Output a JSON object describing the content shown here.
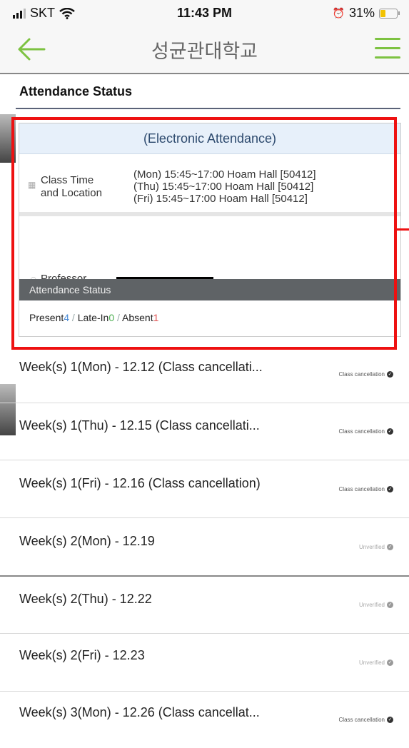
{
  "status_bar": {
    "carrier": "SKT",
    "time": "11:43 PM",
    "battery": "31%"
  },
  "nav": {
    "title": "성균관대학교"
  },
  "section": {
    "title": "Attendance Status"
  },
  "card": {
    "header": "(Electronic Attendance)",
    "class_time_label": "Class Time\nand Location",
    "class_times": [
      "(Mon) 15:45~17:00 Hoam Hall [50412]",
      "(Thu) 15:45~17:00 Hoam Hall [50412]",
      "(Fri) 15:45~17:00 Hoam Hall [50412]"
    ],
    "professor_label": "Professor",
    "attendance_bar": "Attendance Status",
    "summary": {
      "present_label": "Present",
      "present_count": "4",
      "late_label": "Late-In",
      "late_count": "0",
      "absent_label": "Absent",
      "absent_count": "1",
      "separator": " / "
    }
  },
  "weeks": [
    {
      "title": "Week(s) 1(Mon) - 12.12 (Class cancellati...",
      "status": "Class cancellation"
    },
    {
      "title": "Week(s) 1(Thu) - 12.15 (Class cancellati...",
      "status": "Class cancellation"
    },
    {
      "title": "Week(s) 1(Fri) - 12.16 (Class cancellation)",
      "status": "Class cancellation"
    },
    {
      "title": "Week(s) 2(Mon) - 12.19",
      "status": "Unverified"
    },
    {
      "title": "Week(s) 2(Thu) - 12.22",
      "status": "Unverified"
    },
    {
      "title": "Week(s) 2(Fri) - 12.23",
      "status": "Unverified"
    },
    {
      "title": "Week(s) 3(Mon) - 12.26 (Class cancellat...",
      "status": "Class cancellation"
    }
  ],
  "colors": {
    "accent_green": "#7dc241",
    "highlight_red": "#ee1111",
    "present_blue": "#4a8bd6",
    "absent_red": "#e05252"
  }
}
